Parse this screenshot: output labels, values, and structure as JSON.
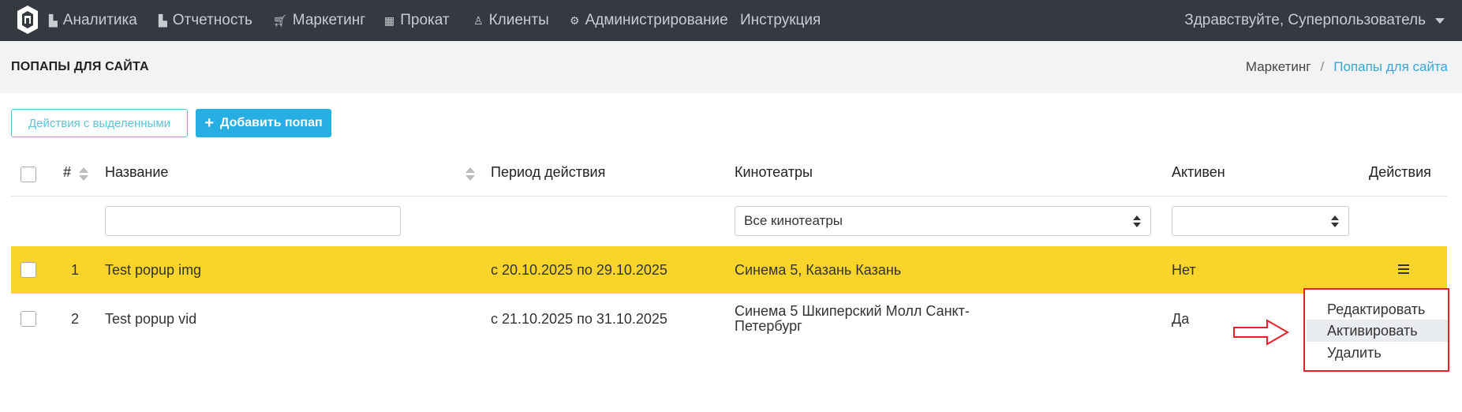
{
  "nav": {
    "items": [
      {
        "label": "Аналитика",
        "icon": "bar-chart-icon"
      },
      {
        "label": "Отчетность",
        "icon": "bar-chart-icon"
      },
      {
        "label": "Маркетинг",
        "icon": "cart-icon"
      },
      {
        "label": "Прокат",
        "icon": "film-icon"
      },
      {
        "label": "Клиенты",
        "icon": "user-icon"
      },
      {
        "label": "Администрирование",
        "icon": "cogs-icon"
      },
      {
        "label": "Инструкция",
        "icon": ""
      }
    ],
    "user_greeting": "Здравствуйте, Суперпользователь"
  },
  "header": {
    "title": "ПОПАПЫ ДЛЯ САЙТА",
    "breadcrumb": [
      "Маркетинг",
      "Попапы для сайта"
    ]
  },
  "toolbar": {
    "bulk_actions_label": "Действия с выделенными",
    "add_label": "Добавить попап"
  },
  "table": {
    "columns": [
      "#",
      "Название",
      "Период действия",
      "Кинотеатры",
      "Активен",
      "Действия"
    ],
    "filters": {
      "name_value": "",
      "cinemas_selected": "Все кинотеатры",
      "active_selected": ""
    },
    "rows": [
      {
        "num": "1",
        "name": "Test popup img",
        "period": "с 20.10.2025 по 29.10.2025",
        "cinemas": "Синема 5, Казань Казань",
        "active": "Нет"
      },
      {
        "num": "2",
        "name": "Test popup vid",
        "period": "с 21.10.2025 по 31.10.2025",
        "cinemas": "Синема 5 Шкиперский Молл Санкт-Петербург",
        "active": "Да"
      }
    ]
  },
  "dropdown": {
    "items": [
      "Редактировать",
      "Активировать",
      "Удалить"
    ]
  },
  "colors": {
    "navbar": "#343a40",
    "highlight_row": "#f9d42b",
    "primary": "#27aee3",
    "outline": "#5cc3d6",
    "annotation": "#e8202a"
  }
}
